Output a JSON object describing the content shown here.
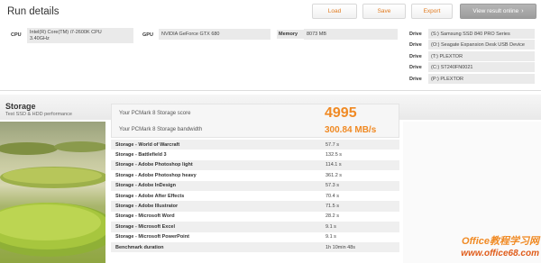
{
  "run_details": {
    "title": "Run details",
    "buttons": {
      "load": "Load",
      "save": "Save",
      "export": "Export",
      "view_online": "View result online"
    },
    "cpu": {
      "label": "CPU",
      "value_line1": "Intel(R) Core(TM) i7-2600K CPU",
      "value_line2": "3.40GHz"
    },
    "gpu": {
      "label": "GPU",
      "value": "NVIDIA GeForce GTX 680"
    },
    "memory": {
      "label": "Memory",
      "value": "8073 MB"
    },
    "drives": [
      {
        "label": "Drive",
        "value": "(S:) Samsung SSD 840 PRO Series"
      },
      {
        "label": "Drive",
        "value": "(O:) Seagate Expansion Desk USB Device"
      },
      {
        "label": "Drive",
        "value": "(T:) PLEXTOR"
      },
      {
        "label": "Drive",
        "value": "(C:) ST240FN0021"
      },
      {
        "label": "Drive",
        "value": "(P:) PLEXTOR"
      }
    ]
  },
  "storage": {
    "title": "Storage",
    "subtitle": "Test SSD & HDD performance",
    "score_label": "Your PCMark 8 Storage score",
    "score_value": "4995",
    "bandwidth_label": "Your PCMark 8 Storage bandwidth",
    "bandwidth_value": "300.84 MB/s",
    "rows": [
      {
        "name": "Storage - World of Warcraft",
        "value": "57.7 s"
      },
      {
        "name": "Storage - Battlefield 3",
        "value": "132.5 s"
      },
      {
        "name": "Storage - Adobe Photoshop light",
        "value": "114.1 s"
      },
      {
        "name": "Storage - Adobe Photoshop heavy",
        "value": "361.2 s"
      },
      {
        "name": "Storage - Adobe InDesign",
        "value": "57.3 s"
      },
      {
        "name": "Storage - Adobe After Effects",
        "value": "70.4 s"
      },
      {
        "name": "Storage - Adobe Illustrator",
        "value": "71.5 s"
      },
      {
        "name": "Storage - Microsoft Word",
        "value": "28.2 s"
      },
      {
        "name": "Storage - Microsoft Excel",
        "value": "9.1 s"
      },
      {
        "name": "Storage - Microsoft PowerPoint",
        "value": "9.1 s"
      },
      {
        "name": "Benchmark duration",
        "value": "1h 10min 48s"
      }
    ]
  },
  "watermark": {
    "line1": "Office教程学习网",
    "line2": "www.office68.com"
  },
  "colors": {
    "accent": "#f08a24",
    "panel_bg": "#eaeaea"
  }
}
